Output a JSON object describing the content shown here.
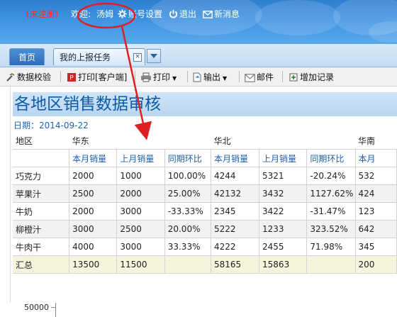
{
  "header": {
    "status": "(未注册)",
    "welcome": "欢迎:",
    "user": "汤姆",
    "account_settings": "账号设置",
    "logout": "退出",
    "new_message": "新消息"
  },
  "tabs": {
    "home": "首页",
    "task": "我的上报任务"
  },
  "toolbar": {
    "validate": "数据校验",
    "print_client": "打印[客户端]",
    "print": "打印",
    "export": "输出",
    "mail": "邮件",
    "add_record": "增加记录"
  },
  "report": {
    "title": "各地区销售数据审核",
    "date": "日期：2014-09-22",
    "region_header": "地区",
    "regions": [
      "华东",
      "华北",
      "华南"
    ],
    "sub_headers": [
      "本月销量",
      "上月销量",
      "同期环比",
      "本月销量",
      "上月销量",
      "同期环比",
      "本月"
    ],
    "rows": [
      {
        "name": "巧克力",
        "cells": [
          "2000",
          "1000",
          "100.00%",
          "4244",
          "5321",
          "-20.24%",
          "532"
        ]
      },
      {
        "name": "苹果汁",
        "cells": [
          "2500",
          "2000",
          "25.00%",
          "42132",
          "3432",
          "1127.62%",
          "424"
        ]
      },
      {
        "name": "牛奶",
        "cells": [
          "2000",
          "3000",
          "-33.33%",
          "2345",
          "3422",
          "-31.47%",
          "123"
        ]
      },
      {
        "name": "柳橙汁",
        "cells": [
          "3000",
          "2500",
          "20.00%",
          "5222",
          "1233",
          "323.52%",
          "642"
        ]
      },
      {
        "name": "牛肉干",
        "cells": [
          "4000",
          "3000",
          "33.33%",
          "4222",
          "2455",
          "71.98%",
          "345"
        ]
      }
    ],
    "total": {
      "name": "汇总",
      "cells": [
        "13500",
        "11500",
        "",
        "58165",
        "15863",
        "",
        "200"
      ]
    },
    "chart_axis_label": "50000"
  },
  "colors": {
    "banner": "#3f93e2",
    "status_red": "#ff2a2a",
    "title_blue": "#0d5aa9",
    "annotation_red": "#e02020"
  },
  "icons": {
    "settings": "gear-icon",
    "logout": "power-icon",
    "message": "envelope-icon"
  }
}
